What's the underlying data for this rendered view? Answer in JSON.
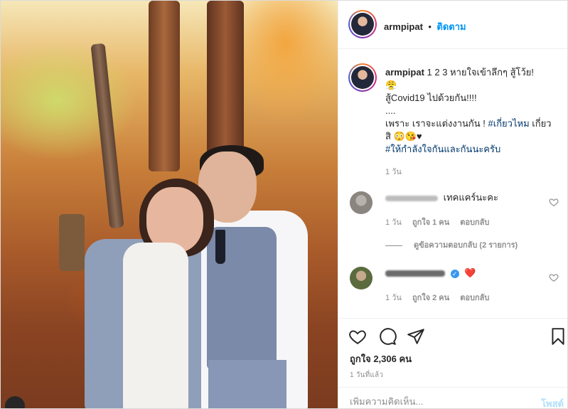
{
  "post": {
    "username": "armpipat",
    "follow_label": "ติดตาม",
    "separator": "•",
    "caption": {
      "line1": "1 2 3 หายใจเข้าลึกๆ สู้โว้ย!",
      "line1_emoji": "😤",
      "line2": "สู้Covid19 ไปด้วยกัน!!!!",
      "line3": "....",
      "line4_prefix": "เพราะ เราจะแต่งงานกัน ! ",
      "line4_tag": "#เกี่ยวไหม",
      "line4_suffix": " เกี่ยว",
      "line5_text": "สิ",
      "line5_emoji": "😳😘♥",
      "line6_tag": "#ให้กำลังใจกันและกันนะครับ"
    },
    "caption_time": "1 วัน"
  },
  "comments": [
    {
      "text": "เทคแคร์นะคะ",
      "time": "1 วัน",
      "likes_label": "ถูกใจ 1 คน",
      "reply_label": "ตอบกลับ",
      "view_replies": "ดูข้อความตอบกลับ (2 รายการ)"
    },
    {
      "text_emoji": "❤️",
      "verified_mark": "✓",
      "time": "1 วัน",
      "likes_label": "ถูกใจ 2 คน",
      "reply_label": "ตอบกลับ"
    }
  ],
  "actions": {
    "likes": "ถูกใจ 2,306 คน",
    "posted_ago": "1 วันที่แล้ว"
  },
  "composer": {
    "placeholder": "เพิ่มความคิดเห็น...",
    "post_label": "โพสต์"
  },
  "colors": {
    "accent": "#0095f6",
    "hashtag": "#00376b",
    "muted": "#8e8e8e"
  },
  "icons": {
    "like": "heart-icon",
    "comment": "comment-icon",
    "share": "paper-plane-icon",
    "save": "bookmark-icon"
  }
}
